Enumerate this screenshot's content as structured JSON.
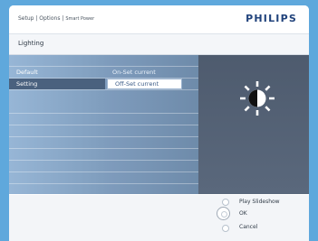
{
  "header": {
    "breadcrumb_main": "Setup | Options |",
    "breadcrumb_sub": "Smart Power",
    "logo": "PHILIPS"
  },
  "subheader": {
    "title": "Lighting"
  },
  "menu": {
    "column1": [
      "Default",
      "Setting"
    ],
    "column1_selected": "Setting",
    "column2": [
      "On-Set current",
      "Off-Set current"
    ],
    "column2_selected": "Off-Set current"
  },
  "preview": {
    "icon": "brightness-icon"
  },
  "footer": {
    "options": [
      "Play Slideshow",
      "OK",
      "Cancel"
    ]
  },
  "colors": {
    "background": "#5fa8dc",
    "logo": "#20427b",
    "highlight": "#4a617e"
  }
}
